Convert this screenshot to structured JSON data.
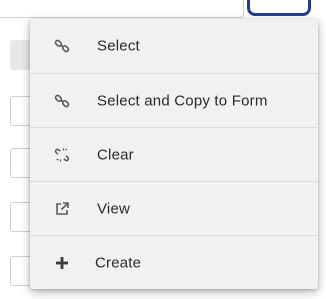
{
  "menu": {
    "items": [
      {
        "label": "Select",
        "icon": "link-icon"
      },
      {
        "label": "Select and Copy to Form",
        "icon": "link-icon"
      },
      {
        "label": "Clear",
        "icon": "unlink-icon"
      },
      {
        "label": "View",
        "icon": "external-link-icon"
      },
      {
        "label": "Create",
        "icon": "plus-icon"
      }
    ]
  },
  "colors": {
    "menu_bg": "#f1f1f1",
    "text": "#2a2a2a",
    "icon": "#5a5a5a",
    "accent_border": "#1f3f8f"
  }
}
